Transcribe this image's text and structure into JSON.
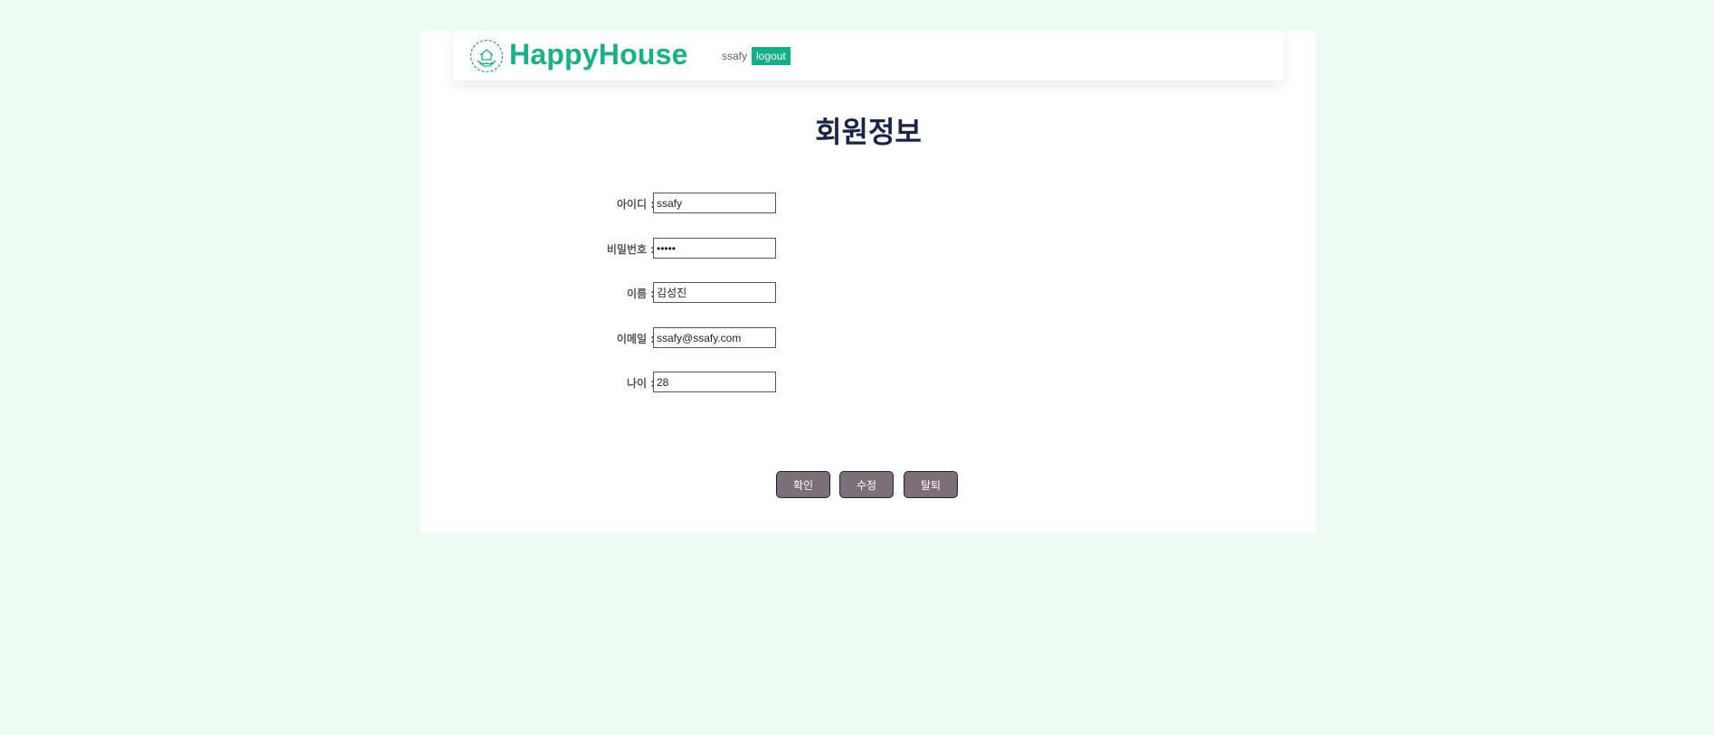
{
  "header": {
    "logo_icon": "house-hands-icon",
    "brand": "HappyHouse",
    "username": "ssafy",
    "logout_label": "logout"
  },
  "page_title": "회원정보",
  "form": {
    "id_label": "아이디 :",
    "id_value": "ssafy",
    "password_label": "비밀번호 :",
    "password_value": "ssafy",
    "name_label": "이름 :",
    "name_value": "김성진",
    "email_label": "이메일 :",
    "email_value": "ssafy@ssafy.com",
    "age_label": "나이 :",
    "age_value": "28"
  },
  "buttons": {
    "confirm": "확인",
    "edit": "수정",
    "withdraw": "탈퇴"
  },
  "colors": {
    "background": "#eefbf3",
    "brand": "#16b289",
    "logout_bg": "#11b086",
    "title": "#17254a",
    "button_bg": "#7d6f78"
  }
}
